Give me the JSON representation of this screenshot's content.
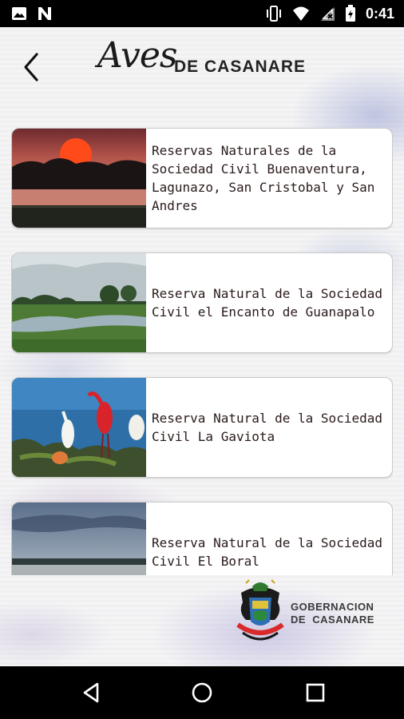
{
  "status_bar": {
    "time": "0:41",
    "left_icons": [
      "image-icon",
      "n-logo-icon"
    ],
    "right_icons": [
      "vibrate-icon",
      "wifi-icon",
      "signal-icon",
      "battery-icon"
    ]
  },
  "header": {
    "title_script": "Aves",
    "title_rest": "DE CASANARE",
    "back_icon": "chevron-left-icon"
  },
  "reserves": [
    {
      "label": "Reservas Naturales de la Sociedad Civil Buenaventura, Lagunazo, San Cristobal y San Andres"
    },
    {
      "label": "Reserva Natural de la Sociedad Civil el Encanto de Guanapalo"
    },
    {
      "label": "Reserva Natural de la Sociedad Civil La Gaviota"
    },
    {
      "label": "Reserva Natural de la Sociedad Civil El Boral"
    }
  ],
  "footer": {
    "line1": "GOBERNACION",
    "line2": "DE  CASANARE"
  },
  "nav": {
    "back_icon": "triangle-back-icon",
    "home_icon": "circle-home-icon",
    "recents_icon": "square-recents-icon"
  }
}
